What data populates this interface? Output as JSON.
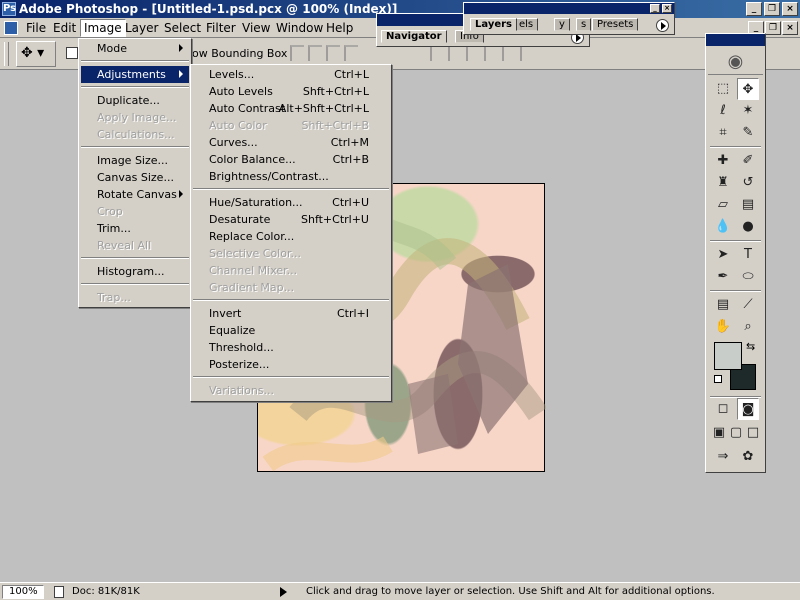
{
  "app": {
    "title": "Adobe Photoshop - [Untitled-1.psd.pcx @ 100% (Index)]"
  },
  "menubar": {
    "items": [
      "File",
      "Edit",
      "Image",
      "Layer",
      "Select",
      "Filter",
      "View",
      "Window",
      "Help"
    ],
    "active": "Image"
  },
  "optionsbar": {
    "show_bbox_label": "ow Bounding Box"
  },
  "image_menu": {
    "items": [
      {
        "label": "Mode",
        "submenu": true,
        "disabled": false
      },
      {
        "label": "Adjustments",
        "submenu": true,
        "disabled": false,
        "highlighted": true
      },
      {
        "label": "Duplicate...",
        "disabled": false
      },
      {
        "label": "Apply Image...",
        "disabled": true
      },
      {
        "label": "Calculations...",
        "disabled": true
      },
      {
        "label": "Image Size...",
        "disabled": false
      },
      {
        "label": "Canvas Size...",
        "disabled": false
      },
      {
        "label": "Rotate Canvas",
        "submenu": true,
        "disabled": false
      },
      {
        "label": "Crop",
        "disabled": true
      },
      {
        "label": "Trim...",
        "disabled": false
      },
      {
        "label": "Reveal All",
        "disabled": true
      },
      {
        "label": "Histogram...",
        "disabled": false
      },
      {
        "label": "Trap...",
        "disabled": true
      }
    ]
  },
  "adjustments_menu": {
    "items": [
      {
        "label": "Levels...",
        "shortcut": "Ctrl+L",
        "disabled": false
      },
      {
        "label": "Auto Levels",
        "shortcut": "Shft+Ctrl+L",
        "disabled": false
      },
      {
        "label": "Auto Contrast",
        "shortcut": "Alt+Shft+Ctrl+L",
        "disabled": false
      },
      {
        "label": "Auto Color",
        "shortcut": "Shft+Ctrl+B",
        "disabled": true
      },
      {
        "label": "Curves...",
        "shortcut": "Ctrl+M",
        "disabled": false
      },
      {
        "label": "Color Balance...",
        "shortcut": "Ctrl+B",
        "disabled": false
      },
      {
        "label": "Brightness/Contrast...",
        "shortcut": "",
        "disabled": false
      },
      {
        "label": "Hue/Saturation...",
        "shortcut": "Ctrl+U",
        "disabled": false
      },
      {
        "label": "Desaturate",
        "shortcut": "Shft+Ctrl+U",
        "disabled": false
      },
      {
        "label": "Replace Color...",
        "shortcut": "",
        "disabled": false
      },
      {
        "label": "Selective Color...",
        "shortcut": "",
        "disabled": true
      },
      {
        "label": "Channel Mixer...",
        "shortcut": "",
        "disabled": true
      },
      {
        "label": "Gradient Map...",
        "shortcut": "",
        "disabled": true
      },
      {
        "label": "Invert",
        "shortcut": "Ctrl+I",
        "disabled": false
      },
      {
        "label": "Equalize",
        "shortcut": "",
        "disabled": false
      },
      {
        "label": "Threshold...",
        "shortcut": "",
        "disabled": false
      },
      {
        "label": "Posterize...",
        "shortcut": "",
        "disabled": false
      },
      {
        "label": "Variations...",
        "shortcut": "",
        "disabled": true
      }
    ]
  },
  "palettes": {
    "navigator_tabs": [
      "Navigator",
      "Info"
    ],
    "layers_tabs": [
      "Layers",
      "els",
      "y",
      "s",
      "Presets"
    ]
  },
  "toolbox": {
    "logo_icon": "eye-icon",
    "foreground_color": "#c8cdc9",
    "background_color": "#1e2a2a"
  },
  "statusbar": {
    "zoom": "100%",
    "doc": "Doc: 81K/81K",
    "hint": "Click and drag to move layer or selection. Use Shift and Alt for additional options."
  }
}
